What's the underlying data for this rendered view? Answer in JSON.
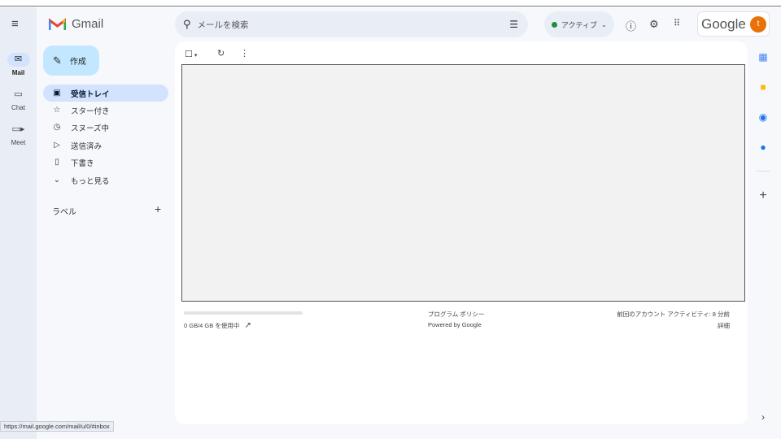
{
  "app": {
    "name": "Gmail"
  },
  "rail": [
    {
      "label": "Mail",
      "icon": "mail-icon"
    },
    {
      "label": "Chat",
      "icon": "chat-icon"
    },
    {
      "label": "Meet",
      "icon": "video-icon"
    }
  ],
  "compose": {
    "label": "作成"
  },
  "nav": [
    {
      "label": "受信トレイ",
      "icon": "inbox-icon"
    },
    {
      "label": "スター付き",
      "icon": "star-icon"
    },
    {
      "label": "スヌーズ中",
      "icon": "clock-icon"
    },
    {
      "label": "送信済み",
      "icon": "send-icon"
    },
    {
      "label": "下書き",
      "icon": "draft-icon"
    },
    {
      "label": "もっと見る",
      "icon": "chevron-down-icon"
    }
  ],
  "labels": {
    "title": "ラベル",
    "add": "+"
  },
  "search": {
    "placeholder": "メールを検索"
  },
  "status": {
    "label": "アクティブ",
    "color": "#1e8e3e"
  },
  "account": {
    "brand": "Google",
    "avatar": "t",
    "avatar_color": "#e8710a"
  },
  "footer": {
    "storage": "0 GB/4 GB を使用中",
    "storage_used_fraction": 0,
    "policy": "プログラム ポリシー",
    "powered": "Powered by Google",
    "last_activity": "前回のアカウント アクティビティ: 8 分前",
    "details": "詳細"
  },
  "statusbar": {
    "url": "https://mail.google.com/mail/u/0/#inbox"
  }
}
